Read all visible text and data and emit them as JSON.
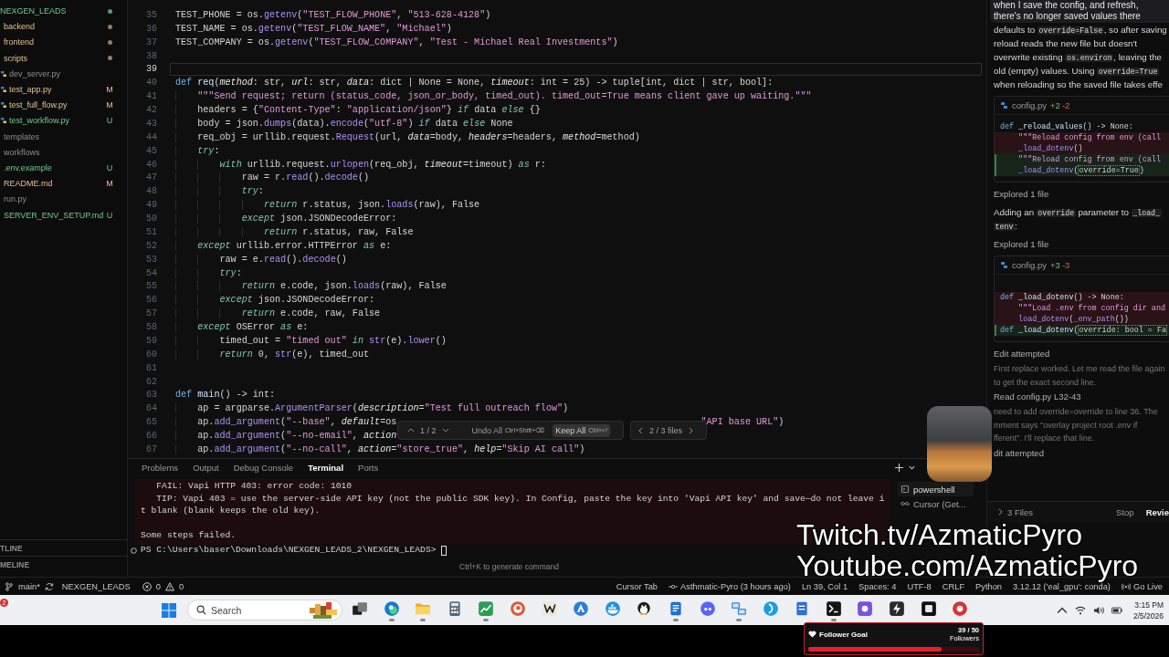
{
  "explorer": {
    "tree": [
      {
        "name": "NEXGEN_LEADS",
        "kind": "untracked",
        "children": [
          {
            "name": "backend",
            "kind": "modified"
          },
          {
            "name": "frontend",
            "kind": "modified"
          },
          {
            "name": "scripts",
            "kind": "modified",
            "children": [
              {
                "name": "dev_server.py",
                "kind": "plain"
              },
              {
                "name": "test_app.py",
                "kind": "modified",
                "badge": "M"
              },
              {
                "name": "test_full_flow.py",
                "kind": "modified",
                "badge": "M"
              },
              {
                "name": "test_workflow.py",
                "kind": "untracked",
                "badge": "U"
              }
            ]
          },
          {
            "name": "templates",
            "kind": "plain"
          },
          {
            "name": "workflows",
            "kind": "plain"
          },
          {
            "name": ".env.example",
            "kind": "untracked",
            "badge": "U"
          },
          {
            "name": "README.md",
            "kind": "modified",
            "badge": "M"
          },
          {
            "name": "run.py",
            "kind": "plain"
          },
          {
            "name": "SERVER_ENV_SETUP.md",
            "kind": "untracked",
            "badge": "U"
          }
        ]
      }
    ],
    "sections": [
      "TLINE",
      "MELINE"
    ]
  },
  "editor": {
    "lines": [
      {
        "number": "35",
        "current": false,
        "tokens": [
          {
            "kind": "plain",
            "text": "TEST_PHONE = os."
          },
          {
            "kind": "call",
            "text": "getenv"
          },
          {
            "kind": "plain",
            "text": "("
          },
          {
            "kind": "str",
            "text": "\"TEST_FLOW_PHONE\""
          },
          {
            "kind": "plain",
            "text": ", "
          },
          {
            "kind": "str",
            "text": "\"513-628-4128\""
          },
          {
            "kind": "plain",
            "text": ")"
          }
        ]
      },
      {
        "number": "36",
        "current": false,
        "tokens": [
          {
            "kind": "plain",
            "text": "TEST_NAME = os."
          },
          {
            "kind": "call",
            "text": "getenv"
          },
          {
            "kind": "plain",
            "text": "("
          },
          {
            "kind": "str",
            "text": "\"TEST_FLOW_NAME\""
          },
          {
            "kind": "plain",
            "text": ", "
          },
          {
            "kind": "str",
            "text": "\"Michael\""
          },
          {
            "kind": "plain",
            "text": ")"
          }
        ]
      },
      {
        "number": "37",
        "current": false,
        "tokens": [
          {
            "kind": "plain",
            "text": "TEST_COMPANY = os."
          },
          {
            "kind": "call",
            "text": "getenv"
          },
          {
            "kind": "plain",
            "text": "("
          },
          {
            "kind": "str",
            "text": "\"TEST_FLOW_COMPANY\""
          },
          {
            "kind": "plain",
            "text": ", "
          },
          {
            "kind": "str",
            "text": "\"Test - Michael Real Investments\""
          },
          {
            "kind": "plain",
            "text": ")"
          }
        ]
      },
      {
        "number": "38",
        "current": false
      },
      {
        "number": "39",
        "current": true
      },
      {
        "number": "40",
        "current": false,
        "tokens": [
          {
            "kind": "def",
            "text": "def "
          },
          {
            "kind": "fn",
            "text": "req"
          },
          {
            "kind": "plain",
            "text": "("
          },
          {
            "kind": "param",
            "text": "method"
          },
          {
            "kind": "plain",
            "text": ": str, "
          },
          {
            "kind": "param",
            "text": "url"
          },
          {
            "kind": "plain",
            "text": ": str, "
          },
          {
            "kind": "param",
            "text": "data"
          },
          {
            "kind": "plain",
            "text": ": dict | None = None, "
          },
          {
            "kind": "param",
            "text": "timeout"
          },
          {
            "kind": "plain",
            "text": ": int = 25) -> tuple[int, dict | str, bool]:"
          }
        ]
      },
      {
        "number": "41",
        "current": false,
        "tokens": [
          {
            "kind": "str",
            "text": "    \"\"\"Send request; return (status_code, json_or_body, timed_out). timed_out=True means client gave up waiting.\"\"\""
          }
        ]
      },
      {
        "number": "42",
        "current": false,
        "tokens": [
          {
            "kind": "plain",
            "text": "    headers = {"
          },
          {
            "kind": "str",
            "text": "\"Content-Type\""
          },
          {
            "kind": "plain",
            "text": ": "
          },
          {
            "kind": "str",
            "text": "\"application/json\""
          },
          {
            "kind": "plain",
            "text": "} "
          },
          {
            "kind": "kw",
            "text": "if"
          },
          {
            "kind": "plain",
            "text": " data "
          },
          {
            "kind": "kw",
            "text": "else"
          },
          {
            "kind": "plain",
            "text": " {}"
          }
        ]
      },
      {
        "number": "43",
        "current": false,
        "tokens": [
          {
            "kind": "plain",
            "text": "    body = json."
          },
          {
            "kind": "call",
            "text": "dumps"
          },
          {
            "kind": "plain",
            "text": "(data)."
          },
          {
            "kind": "call",
            "text": "encode"
          },
          {
            "kind": "plain",
            "text": "("
          },
          {
            "kind": "str",
            "text": "\"utf-8\""
          },
          {
            "kind": "plain",
            "text": ") "
          },
          {
            "kind": "kw",
            "text": "if"
          },
          {
            "kind": "plain",
            "text": " data "
          },
          {
            "kind": "kw",
            "text": "else"
          },
          {
            "kind": "plain",
            "text": " None"
          }
        ]
      },
      {
        "number": "44",
        "current": false,
        "tokens": [
          {
            "kind": "plain",
            "text": "    req_obj = urllib.request."
          },
          {
            "kind": "call",
            "text": "Request"
          },
          {
            "kind": "plain",
            "text": "(url, "
          },
          {
            "kind": "param",
            "text": "data"
          },
          {
            "kind": "plain",
            "text": "=body, "
          },
          {
            "kind": "param",
            "text": "headers"
          },
          {
            "kind": "plain",
            "text": "=headers, "
          },
          {
            "kind": "param",
            "text": "method"
          },
          {
            "kind": "plain",
            "text": "=method)"
          }
        ]
      },
      {
        "number": "45",
        "current": false,
        "tokens": [
          {
            "kind": "kw",
            "text": "    try"
          },
          {
            "kind": "plain",
            "text": ":"
          }
        ]
      },
      {
        "number": "46",
        "current": false,
        "tokens": [
          {
            "kind": "kw",
            "text": "        with"
          },
          {
            "kind": "plain",
            "text": " urllib.request."
          },
          {
            "kind": "call",
            "text": "urlopen"
          },
          {
            "kind": "plain",
            "text": "(req_obj, "
          },
          {
            "kind": "param",
            "text": "timeout"
          },
          {
            "kind": "plain",
            "text": "=timeout) "
          },
          {
            "kind": "kw",
            "text": "as"
          },
          {
            "kind": "plain",
            "text": " r:"
          }
        ]
      },
      {
        "number": "47",
        "current": false,
        "tokens": [
          {
            "kind": "plain",
            "text": "            raw = r."
          },
          {
            "kind": "call",
            "text": "read"
          },
          {
            "kind": "plain",
            "text": "()."
          },
          {
            "kind": "call",
            "text": "decode"
          },
          {
            "kind": "plain",
            "text": "()"
          }
        ]
      },
      {
        "number": "48",
        "current": false,
        "tokens": [
          {
            "kind": "kw",
            "text": "            try"
          },
          {
            "kind": "plain",
            "text": ":"
          }
        ]
      },
      {
        "number": "49",
        "current": false,
        "tokens": [
          {
            "kind": "kw",
            "text": "                return"
          },
          {
            "kind": "plain",
            "text": " r.status, json."
          },
          {
            "kind": "call",
            "text": "loads"
          },
          {
            "kind": "plain",
            "text": "(raw), False"
          }
        ]
      },
      {
        "number": "50",
        "current": false,
        "tokens": [
          {
            "kind": "kw",
            "text": "            except"
          },
          {
            "kind": "plain",
            "text": " json.JSONDecodeError:"
          }
        ]
      },
      {
        "number": "51",
        "current": false,
        "tokens": [
          {
            "kind": "kw",
            "text": "                return"
          },
          {
            "kind": "plain",
            "text": " r.status, raw, False"
          }
        ]
      },
      {
        "number": "52",
        "current": false,
        "tokens": [
          {
            "kind": "kw",
            "text": "    except"
          },
          {
            "kind": "plain",
            "text": " urllib.error.HTTPError "
          },
          {
            "kind": "kw",
            "text": "as"
          },
          {
            "kind": "plain",
            "text": " e:"
          }
        ]
      },
      {
        "number": "53",
        "current": false,
        "tokens": [
          {
            "kind": "plain",
            "text": "        raw = e."
          },
          {
            "kind": "call",
            "text": "read"
          },
          {
            "kind": "plain",
            "text": "()."
          },
          {
            "kind": "call",
            "text": "decode"
          },
          {
            "kind": "plain",
            "text": "()"
          }
        ]
      },
      {
        "number": "54",
        "current": false,
        "tokens": [
          {
            "kind": "kw",
            "text": "        try"
          },
          {
            "kind": "plain",
            "text": ":"
          }
        ]
      },
      {
        "number": "55",
        "current": false,
        "tokens": [
          {
            "kind": "kw",
            "text": "            return"
          },
          {
            "kind": "plain",
            "text": " e.code, json."
          },
          {
            "kind": "call",
            "text": "loads"
          },
          {
            "kind": "plain",
            "text": "(raw), False"
          }
        ]
      },
      {
        "number": "56",
        "current": false,
        "tokens": [
          {
            "kind": "kw",
            "text": "        except"
          },
          {
            "kind": "plain",
            "text": " json.JSONDecodeError:"
          }
        ]
      },
      {
        "number": "57",
        "current": false,
        "tokens": [
          {
            "kind": "kw",
            "text": "            return"
          },
          {
            "kind": "plain",
            "text": " e.code, raw, False"
          }
        ]
      },
      {
        "number": "58",
        "current": false,
        "tokens": [
          {
            "kind": "kw",
            "text": "    except"
          },
          {
            "kind": "plain",
            "text": " OSError "
          },
          {
            "kind": "kw",
            "text": "as"
          },
          {
            "kind": "plain",
            "text": " e:"
          }
        ]
      },
      {
        "number": "59",
        "current": false,
        "tokens": [
          {
            "kind": "plain",
            "text": "        timed_out = "
          },
          {
            "kind": "str",
            "text": "\"timed out\""
          },
          {
            "kind": "kw",
            "text": " in "
          },
          {
            "kind": "call",
            "text": "str"
          },
          {
            "kind": "plain",
            "text": "(e)."
          },
          {
            "kind": "call",
            "text": "lower"
          },
          {
            "kind": "plain",
            "text": "()"
          }
        ]
      },
      {
        "number": "60",
        "current": false,
        "tokens": [
          {
            "kind": "kw",
            "text": "        return"
          },
          {
            "kind": "plain",
            "text": " 0, "
          },
          {
            "kind": "call",
            "text": "str"
          },
          {
            "kind": "plain",
            "text": "(e), timed_out"
          }
        ]
      },
      {
        "number": "61",
        "current": false
      },
      {
        "number": "62",
        "current": false
      },
      {
        "number": "63",
        "current": false,
        "tokens": [
          {
            "kind": "def",
            "text": "def "
          },
          {
            "kind": "fn",
            "text": "main"
          },
          {
            "kind": "plain",
            "text": "() -> int:"
          }
        ]
      },
      {
        "number": "64",
        "current": false,
        "tokens": [
          {
            "kind": "plain",
            "text": "    ap = argparse."
          },
          {
            "kind": "call",
            "text": "ArgumentParser"
          },
          {
            "kind": "plain",
            "text": "("
          },
          {
            "kind": "param",
            "text": "description"
          },
          {
            "kind": "plain",
            "text": "="
          },
          {
            "kind": "str",
            "text": "\"Test full outreach flow\""
          },
          {
            "kind": "plain",
            "text": ")"
          }
        ]
      },
      {
        "number": "65",
        "current": false,
        "tokens": [
          {
            "kind": "plain",
            "text": "    ap."
          },
          {
            "kind": "call",
            "text": "add_argument"
          },
          {
            "kind": "plain",
            "text": "("
          },
          {
            "kind": "str",
            "text": "\"--base\""
          },
          {
            "kind": "plain",
            "text": ", "
          },
          {
            "kind": "param",
            "text": "default"
          },
          {
            "kind": "plain",
            "text": "=os"
          }
        ],
        "after_overlay": [
          {
            "kind": "str",
            "text": "\"API base URL\""
          },
          {
            "kind": "plain",
            "text": ")"
          }
        ]
      },
      {
        "number": "66",
        "current": false,
        "tokens": [
          {
            "kind": "plain",
            "text": "    ap."
          },
          {
            "kind": "call",
            "text": "add_argument"
          },
          {
            "kind": "plain",
            "text": "("
          },
          {
            "kind": "str",
            "text": "\"--no-email\""
          },
          {
            "kind": "plain",
            "text": ", "
          },
          {
            "kind": "param",
            "text": "action"
          }
        ]
      },
      {
        "number": "67",
        "current": false,
        "tokens": [
          {
            "kind": "plain",
            "text": "    ap."
          },
          {
            "kind": "call",
            "text": "add_argument"
          },
          {
            "kind": "plain",
            "text": "("
          },
          {
            "kind": "str",
            "text": "\"--no-call\""
          },
          {
            "kind": "plain",
            "text": ", "
          },
          {
            "kind": "param",
            "text": "action"
          },
          {
            "kind": "plain",
            "text": "="
          },
          {
            "kind": "str",
            "text": "\"store_true\""
          },
          {
            "kind": "plain",
            "text": ", "
          },
          {
            "kind": "param",
            "text": "help"
          },
          {
            "kind": "plain",
            "text": "="
          },
          {
            "kind": "str",
            "text": "\"Skip AI call\""
          },
          {
            "kind": "plain",
            "text": ")"
          }
        ]
      }
    ]
  },
  "review_bar": {
    "position": "1 / 2",
    "undo": {
      "label": "Undo All",
      "shortcut": "Ctrl+Shift+⌫"
    },
    "keep": {
      "label": "Keep All",
      "shortcut": "Ctrl+⏎"
    },
    "files": "2 / 3 files"
  },
  "panel": {
    "tabs": [
      {
        "label": "Problems",
        "selected": false
      },
      {
        "label": "Output",
        "selected": false
      },
      {
        "label": "Debug Console",
        "selected": false
      },
      {
        "label": "Terminal",
        "selected": true
      },
      {
        "label": "Ports",
        "selected": false
      }
    ],
    "terminal": {
      "output": [
        [
          "   FAIL: Vapi HTTP 403: error code: 1010",
          "   TIP: Vapi 403 = use the server-side API key (not the public SDK key). In Config, paste the key into 'Vapi API key' and save—do not leave i",
          "t blank (blank keeps the old key)."
        ],
        [
          "Some steps failed."
        ]
      ],
      "prompt": "PS C:\\Users\\baser\\Downloads\\NEXGEN_LEADS_2\\NEXGEN_LEADS>",
      "hint": "Ctrl+K to generate command"
    },
    "sessions": [
      {
        "kind": "shell",
        "label": "powershell",
        "selected": true
      },
      {
        "kind": "agent",
        "label": "Cursor (Get...",
        "selected": false
      }
    ]
  },
  "chat": {
    "user_message": [
      "when I save the config, and refresh,",
      "there's no longer saved values there"
    ],
    "blocks": [
      {
        "kind": "paragraph",
        "lines": [
          [
            {
              "kind": "text",
              "text": "defaults to "
            },
            {
              "kind": "code",
              "text": "override=False"
            },
            {
              "kind": "text",
              "text": ", so after saving"
            }
          ],
          [
            {
              "kind": "text",
              "text": "reload reads the new file but doesn't"
            }
          ],
          [
            {
              "kind": "text",
              "text": "overwrite existing "
            },
            {
              "kind": "code",
              "text": "os.environ"
            },
            {
              "kind": "text",
              "text": ", leaving the"
            }
          ],
          [
            {
              "kind": "text",
              "text": "old (empty) values. Using "
            },
            {
              "kind": "code",
              "text": "override=True"
            }
          ],
          [
            {
              "kind": "text",
              "text": "when reloading so the saved file takes effe"
            }
          ]
        ]
      },
      {
        "kind": "diff",
        "file": "config.py",
        "added": "+2",
        "removed": "-2",
        "lines": [
          {
            "kind": "context",
            "tokens": [
              {
                "kind": "def",
                "text": "def "
              },
              {
                "kind": "fn",
                "text": "_reload_values"
              },
              {
                "kind": "plain",
                "text": "() -> None:"
              }
            ]
          },
          {
            "kind": "removed",
            "tokens": [
              {
                "kind": "str",
                "text": "    \"\"\"Reload config from env (call"
              }
            ]
          },
          {
            "kind": "removed",
            "tokens": [
              {
                "kind": "call",
                "text": "    _load_dotenv"
              },
              {
                "kind": "plain",
                "text": "()"
              }
            ]
          },
          {
            "kind": "added",
            "tokens": [
              {
                "kind": "str",
                "text": "    \"\"\"Reload config from env (call"
              }
            ]
          },
          {
            "kind": "added",
            "tokens": [
              {
                "kind": "call",
                "text": "    _load_dotenv"
              },
              {
                "kind": "plain",
                "text": "("
              },
              {
                "kind": "changed",
                "text": "override=True"
              },
              {
                "kind": "plain",
                "text": ")"
              }
            ]
          }
        ]
      },
      {
        "kind": "status",
        "text": "Explored 1 file"
      },
      {
        "kind": "paragraph",
        "lines": [
          [
            {
              "kind": "text",
              "text": "Adding an "
            },
            {
              "kind": "code",
              "text": "override"
            },
            {
              "kind": "text",
              "text": " parameter to "
            },
            {
              "kind": "code",
              "text": "_load_"
            }
          ],
          [
            {
              "kind": "code",
              "text": "tenv"
            },
            {
              "kind": "text",
              "text": ":"
            }
          ]
        ]
      },
      {
        "kind": "status",
        "text": "Explored 1 file"
      },
      {
        "kind": "diff",
        "file": "config.py",
        "added": "+3",
        "removed": "-3",
        "lines": [
          {
            "kind": "context"
          },
          {
            "kind": "removed",
            "tokens": [
              {
                "kind": "def",
                "text": "def "
              },
              {
                "kind": "fn",
                "text": "_load_dotenv"
              },
              {
                "kind": "plain",
                "text": "() -> None:"
              }
            ]
          },
          {
            "kind": "removed",
            "tokens": [
              {
                "kind": "str",
                "text": "    \"\"\"Load .env from config dir and"
              }
            ]
          },
          {
            "kind": "removed",
            "tokens": [
              {
                "kind": "call",
                "text": "    load_dotenv"
              },
              {
                "kind": "plain",
                "text": "("
              },
              {
                "kind": "call",
                "text": "_env_path"
              },
              {
                "kind": "plain",
                "text": "())"
              }
            ]
          },
          {
            "kind": "added",
            "tokens": [
              {
                "kind": "def",
                "text": "def "
              },
              {
                "kind": "fn",
                "text": "_load_dotenv"
              },
              {
                "kind": "plain",
                "text": "("
              },
              {
                "kind": "changed",
                "text": "override: bool = Fa"
              }
            ]
          }
        ]
      },
      {
        "kind": "status",
        "text": "Edit attempted"
      },
      {
        "kind": "note",
        "lines": [
          "First replace worked. Let me read the file again",
          "to get the exact second line."
        ]
      },
      {
        "kind": "status",
        "text": "Read config.py L32-43"
      },
      {
        "kind": "note",
        "lines": [
          "need to add override=override to line 36. The",
          "mment says \"overlay project root .env if",
          "fferent\". I'll replace that line."
        ]
      },
      {
        "kind": "status",
        "text": "dit attempted"
      }
    ],
    "footer": {
      "files": "3 Files",
      "stop": "Stop",
      "review": "Revie"
    }
  },
  "status_bar": {
    "branch": "main*",
    "folder": "NEXGEN_LEADS",
    "errors": "0",
    "warnings": "0",
    "items": [
      {
        "kind": "text",
        "text": "Cursor Tab"
      },
      {
        "kind": "commit",
        "text": "Asthmatic-Pyro (3 hours ago)"
      },
      {
        "kind": "text",
        "text": "Ln 39, Col 1"
      },
      {
        "kind": "text",
        "text": "Spaces: 4"
      },
      {
        "kind": "text",
        "text": "UTF-8"
      },
      {
        "kind": "text",
        "text": "CRLF"
      },
      {
        "kind": "text",
        "text": "Python"
      },
      {
        "kind": "text",
        "text": "3.12.12 ('eal_gpu': conda)"
      },
      {
        "kind": "live",
        "text": "Go Live"
      }
    ]
  },
  "taskbar": {
    "badge": "2",
    "search": {
      "placeholder": "Search"
    },
    "apps": [
      {
        "running": false
      },
      {
        "running": true
      },
      {
        "running": true
      },
      {
        "running": false
      },
      {
        "running": true
      },
      {
        "running": false
      },
      {
        "running": false
      },
      {
        "running": false
      },
      {
        "running": false
      },
      {
        "running": false
      },
      {
        "running": true
      },
      {
        "running": false
      },
      {
        "running": true
      },
      {
        "running": false
      },
      {
        "running": false
      },
      {
        "running": true
      },
      {
        "running": false
      },
      {
        "running": false
      },
      {
        "running": false
      },
      {
        "running": false
      }
    ],
    "clock": {
      "time": "3:15 PM",
      "date": "2/5/2026"
    }
  },
  "stream_overlay": {
    "handles": [
      "Twitch.tv/AzmaticPyro",
      "Youtube.com/AzmaticPyro"
    ],
    "follower_goal": {
      "title": "Follower Goal",
      "count": "39 / 50",
      "unit": "Followers",
      "level": 0.78
    }
  }
}
